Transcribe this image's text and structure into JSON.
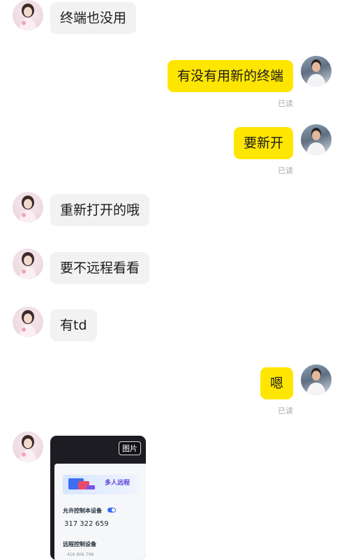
{
  "messages": [
    {
      "side": "left",
      "text": "终端也没用"
    },
    {
      "side": "right",
      "text": "有没有用新的终端",
      "status": "已读"
    },
    {
      "side": "right",
      "text": "要新开",
      "status": "已读"
    },
    {
      "side": "left",
      "text": "重新打开的哦"
    },
    {
      "side": "left",
      "text": "要不远程看看"
    },
    {
      "side": "left",
      "text": "有td"
    },
    {
      "side": "right",
      "text": "嗯",
      "status": "已读"
    }
  ],
  "image_message": {
    "badge": "图片",
    "screen_banner": "多人远程",
    "section1_title": "允许控制本设备",
    "device_id": "317 322 659",
    "section2_title": "远程控制设备",
    "partial_id": "416 606 798"
  },
  "colors": {
    "my_bubble": "#ffe600",
    "their_bubble": "#f2f2f2",
    "read_status": "#a8a8a8"
  },
  "icons": {
    "avatar_contact": "contact-avatar",
    "avatar_self": "self-avatar"
  }
}
